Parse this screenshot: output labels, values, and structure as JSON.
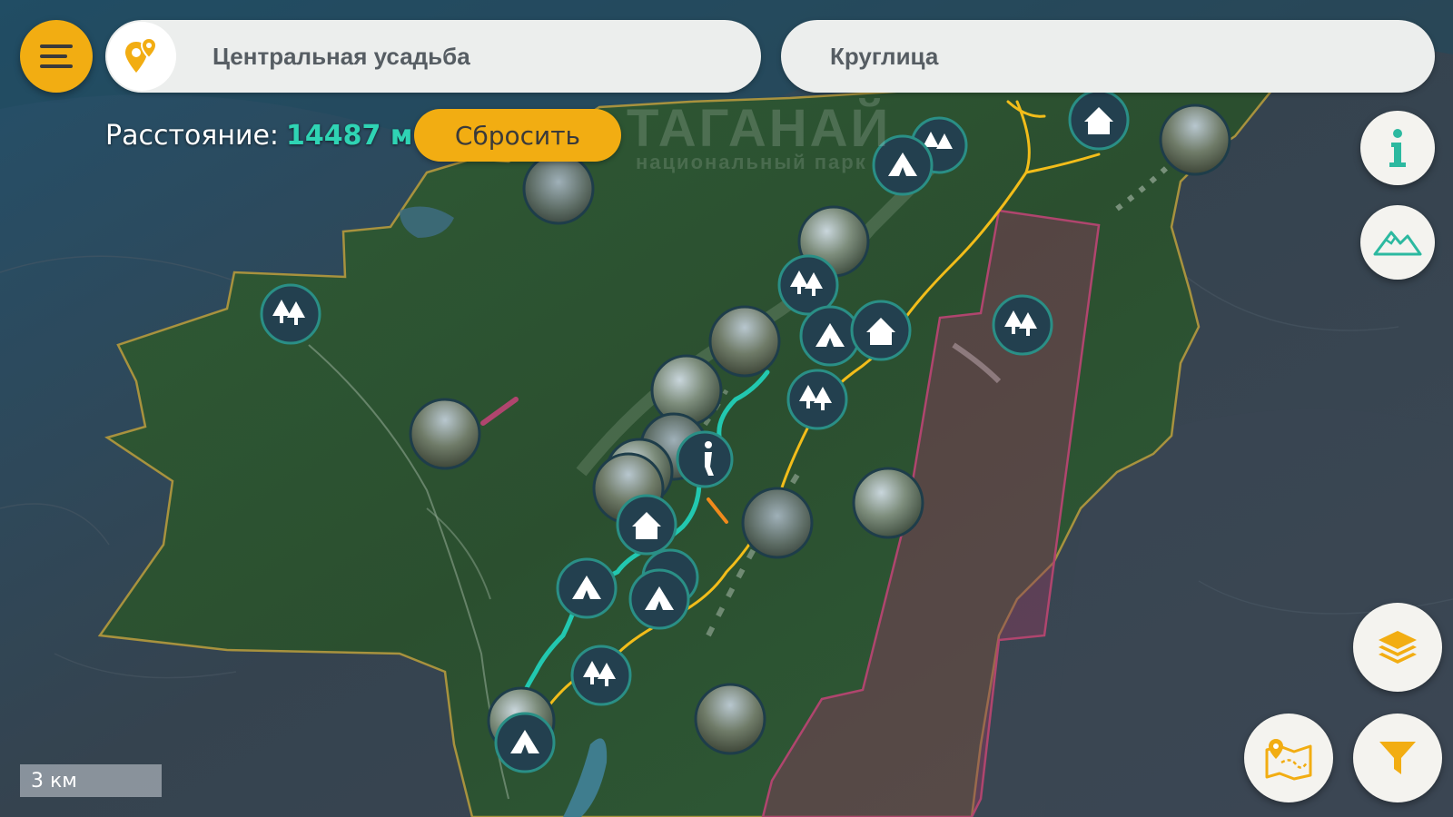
{
  "search": {
    "from_value": "Центральная усадьба",
    "to_value": "Круглица"
  },
  "route": {
    "distance_label": "Расстояние:",
    "distance_value": "14487 м",
    "reset_label": "Сбросить"
  },
  "map": {
    "watermark_title": "ТАГАНАЙ",
    "watermark_subtitle": "национальный парк",
    "scale_label": "3 км"
  },
  "icons": {
    "menu": "hamburger-menu-icon",
    "location": "location-pin-icon",
    "info": "info-icon",
    "mountain": "mountain-icon",
    "layers": "layers-icon",
    "routes": "map-route-icon",
    "filter": "filter-funnel-icon",
    "marker_forest": "forest-icon",
    "marker_tent": "tent-icon",
    "marker_house": "house-icon",
    "marker_hiker": "hiker-icon",
    "marker_photo": "photo-point"
  },
  "colors": {
    "accent": "#f2ad12",
    "distance": "#2fd4b4",
    "route_teal": "#22c8b0",
    "route_yellow": "#f2bd1a",
    "boundary": "#b59a3a",
    "restricted_zone": "#a0375f",
    "marker_bg": "#23404f"
  }
}
